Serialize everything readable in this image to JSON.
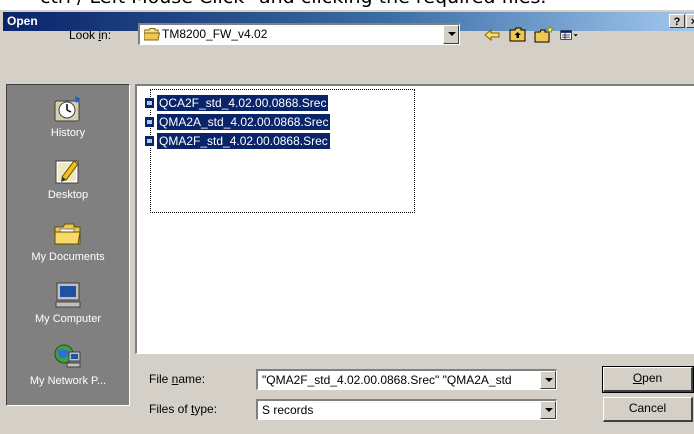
{
  "caption": "ctrl / Left Mouse Click\" and clicking the required files.",
  "dialog": {
    "title": "Open",
    "help_label": "?",
    "close_label": "×"
  },
  "look_in": {
    "label_pre": "Look ",
    "label_key": "i",
    "label_post": "n:",
    "value": "TM8200_FW_v4.02"
  },
  "places": [
    {
      "label": "History",
      "icon": "history-icon"
    },
    {
      "label": "Desktop",
      "icon": "desktop-icon"
    },
    {
      "label": "My Documents",
      "icon": "my-documents-icon"
    },
    {
      "label": "My Computer",
      "icon": "my-computer-icon"
    },
    {
      "label": "My Network P...",
      "icon": "my-network-places-icon"
    }
  ],
  "files": [
    {
      "name": "QCA2F_std_4.02.00.0868.Srec"
    },
    {
      "name": "QMA2A_std_4.02.00.0868.Srec"
    },
    {
      "name": "QMA2F_std_4.02.00.0868.Srec"
    }
  ],
  "file_name": {
    "label_pre": "File ",
    "label_key": "n",
    "label_post": "ame:",
    "value": "\"QMA2F_std_4.02.00.0868.Srec\" \"QMA2A_std"
  },
  "file_type": {
    "label_pre": "Files of ",
    "label_key": "t",
    "label_post": "ype:",
    "value": "S records"
  },
  "buttons": {
    "open_key": "O",
    "open_rest": "pen",
    "cancel": "Cancel"
  },
  "colors": {
    "title_start": "#0a246a",
    "title_end": "#a6caf0",
    "selection": "#0a246a",
    "face": "#d4d0c8",
    "places_bg": "#808080"
  }
}
